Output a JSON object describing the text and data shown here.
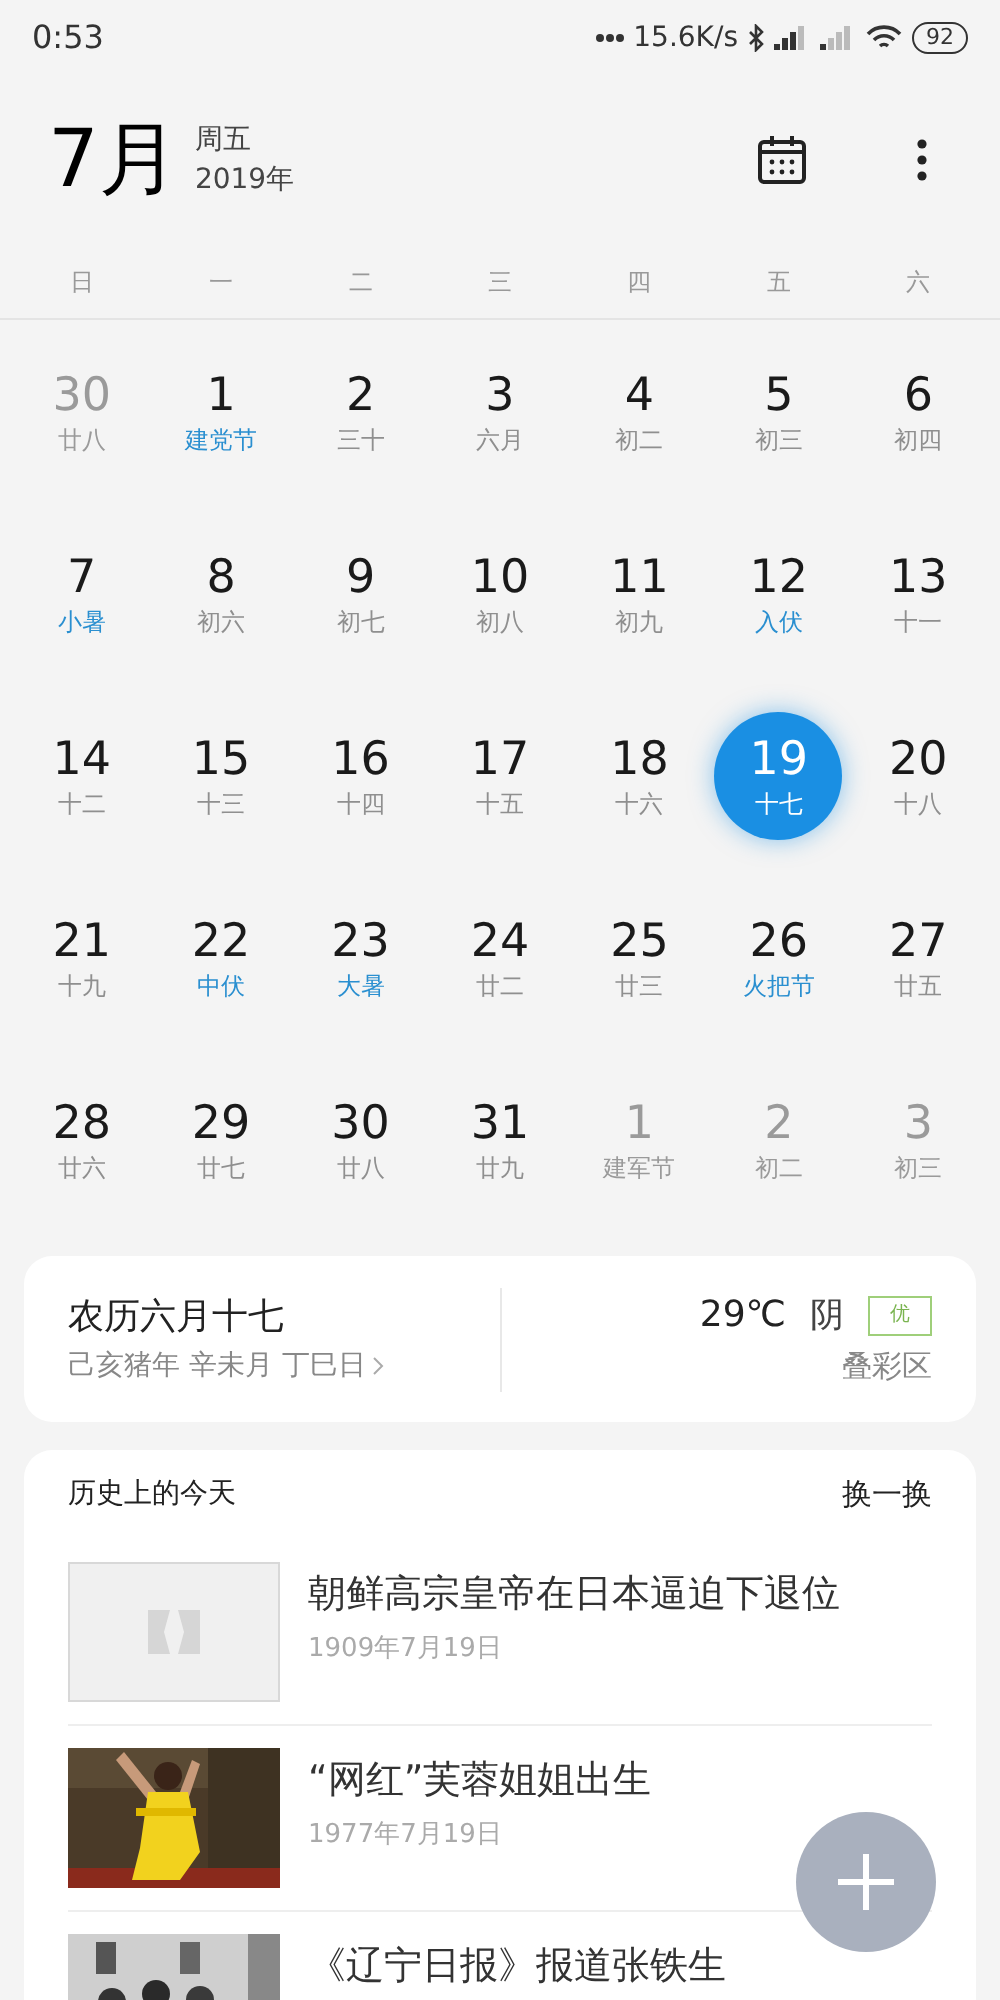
{
  "status_bar": {
    "time": "0:53",
    "speed": "15.6K/s",
    "battery": "92"
  },
  "header": {
    "month": "7月",
    "weekday": "周五",
    "year": "2019年"
  },
  "weekdays": [
    "日",
    "一",
    "二",
    "三",
    "四",
    "五",
    "六"
  ],
  "weeks": [
    [
      {
        "day": "30",
        "lunar": "廿八",
        "kind": "other",
        "selected": false
      },
      {
        "day": "1",
        "lunar": "建党节",
        "kind": "festival",
        "selected": false
      },
      {
        "day": "2",
        "lunar": "三十",
        "kind": "normal",
        "selected": false
      },
      {
        "day": "3",
        "lunar": "六月",
        "kind": "normal",
        "selected": false
      },
      {
        "day": "4",
        "lunar": "初二",
        "kind": "normal",
        "selected": false
      },
      {
        "day": "5",
        "lunar": "初三",
        "kind": "normal",
        "selected": false
      },
      {
        "day": "6",
        "lunar": "初四",
        "kind": "normal",
        "selected": false
      }
    ],
    [
      {
        "day": "7",
        "lunar": "小暑",
        "kind": "festival",
        "selected": false
      },
      {
        "day": "8",
        "lunar": "初六",
        "kind": "normal",
        "selected": false
      },
      {
        "day": "9",
        "lunar": "初七",
        "kind": "normal",
        "selected": false
      },
      {
        "day": "10",
        "lunar": "初八",
        "kind": "normal",
        "selected": false
      },
      {
        "day": "11",
        "lunar": "初九",
        "kind": "normal",
        "selected": false
      },
      {
        "day": "12",
        "lunar": "入伏",
        "kind": "festival",
        "selected": false
      },
      {
        "day": "13",
        "lunar": "十一",
        "kind": "normal",
        "selected": false
      }
    ],
    [
      {
        "day": "14",
        "lunar": "十二",
        "kind": "normal",
        "selected": false
      },
      {
        "day": "15",
        "lunar": "十三",
        "kind": "normal",
        "selected": false
      },
      {
        "day": "16",
        "lunar": "十四",
        "kind": "normal",
        "selected": false
      },
      {
        "day": "17",
        "lunar": "十五",
        "kind": "normal",
        "selected": false
      },
      {
        "day": "18",
        "lunar": "十六",
        "kind": "normal",
        "selected": false
      },
      {
        "day": "19",
        "lunar": "十七",
        "kind": "normal",
        "selected": true
      },
      {
        "day": "20",
        "lunar": "十八",
        "kind": "normal",
        "selected": false
      }
    ],
    [
      {
        "day": "21",
        "lunar": "十九",
        "kind": "normal",
        "selected": false
      },
      {
        "day": "22",
        "lunar": "中伏",
        "kind": "festival",
        "selected": false
      },
      {
        "day": "23",
        "lunar": "大暑",
        "kind": "festival",
        "selected": false
      },
      {
        "day": "24",
        "lunar": "廿二",
        "kind": "normal",
        "selected": false
      },
      {
        "day": "25",
        "lunar": "廿三",
        "kind": "normal",
        "selected": false
      },
      {
        "day": "26",
        "lunar": "火把节",
        "kind": "festival",
        "selected": false
      },
      {
        "day": "27",
        "lunar": "廿五",
        "kind": "normal",
        "selected": false
      }
    ],
    [
      {
        "day": "28",
        "lunar": "廿六",
        "kind": "normal",
        "selected": false
      },
      {
        "day": "29",
        "lunar": "廿七",
        "kind": "normal",
        "selected": false
      },
      {
        "day": "30",
        "lunar": "廿八",
        "kind": "normal",
        "selected": false
      },
      {
        "day": "31",
        "lunar": "廿九",
        "kind": "normal",
        "selected": false
      },
      {
        "day": "1",
        "lunar": "建军节",
        "kind": "other",
        "selected": false
      },
      {
        "day": "2",
        "lunar": "初二",
        "kind": "other",
        "selected": false
      },
      {
        "day": "3",
        "lunar": "初三",
        "kind": "other",
        "selected": false
      }
    ]
  ],
  "lunar_card": {
    "title": "农历六月十七",
    "ganzhi": "己亥猪年 辛未月 丁巳日",
    "temperature": "29℃",
    "weather": "阴",
    "air_quality": "优",
    "district": "叠彩区"
  },
  "history": {
    "title": "历史上的今天",
    "refresh": "换一换",
    "items": [
      {
        "title": "朝鲜高宗皇帝在日本逼迫下退位",
        "date": "1909年7月19日",
        "kind": "placeholder"
      },
      {
        "title": "“网红”芙蓉姐姐出生",
        "date": "1977年7月19日",
        "kind": "picture"
      },
      {
        "title": "《辽宁日报》报道张铁生",
        "kind": "picture"
      }
    ]
  }
}
